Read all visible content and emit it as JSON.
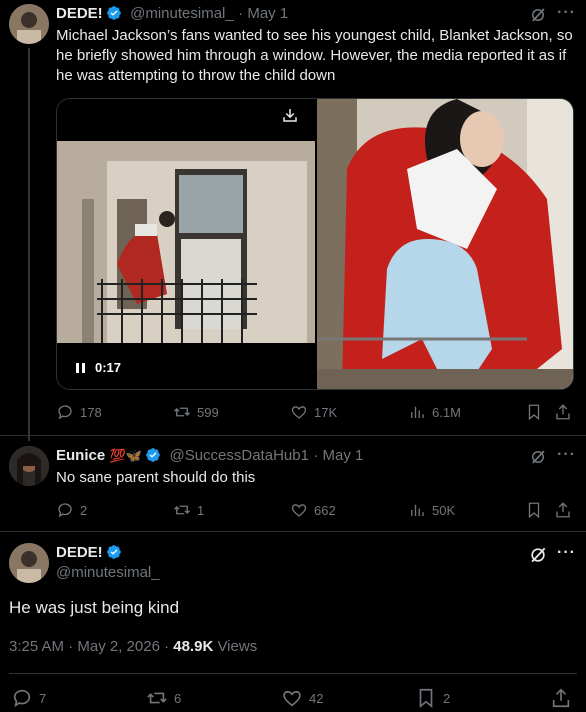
{
  "post1": {
    "name": "DEDE!",
    "handle": "@minutesimal_",
    "date": "· May 1",
    "text": "Michael Jackson’s fans wanted to see his youngest child, Blanket Jackson, so he briefly showed him through a window. However, the media reported it as if he was attempting to throw the child down",
    "video_time": "0:17",
    "replies": "178",
    "reposts": "599",
    "likes": "17K",
    "views": "6.1M"
  },
  "post2": {
    "name": "Eunice",
    "emoji": "💯🦋",
    "handle": "@SuccessDataHub1",
    "date": "· May 1",
    "text": "No sane parent should do this",
    "replies": "2",
    "reposts": "1",
    "likes": "662",
    "views": "50K"
  },
  "post3": {
    "name": "DEDE!",
    "handle": "@minutesimal_",
    "text": "He was just being kind",
    "time": "3:25 AM · May 2, 2026 · ",
    "views_count": "48.9K",
    "views_label": " Views",
    "replies": "7",
    "reposts": "6",
    "likes": "42",
    "bookmarks": "2"
  }
}
